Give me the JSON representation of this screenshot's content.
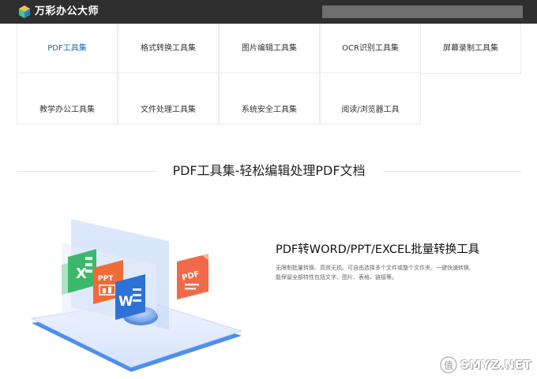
{
  "header": {
    "brand": "万彩办公大师",
    "brand_color": "#2f2f2f",
    "logo_icon": "cube-logo-icon",
    "search_bar_color": "#6f6f6f"
  },
  "tabs": [
    {
      "label": "PDF工具集",
      "active": true
    },
    {
      "label": "格式转换工具集",
      "active": false
    },
    {
      "label": "图片编辑工具集",
      "active": false
    },
    {
      "label": "OCR识别工具集",
      "active": false
    },
    {
      "label": "屏幕录制工具集",
      "active": false
    },
    {
      "label": "教学办公工具集",
      "active": false
    },
    {
      "label": "文件处理工具集",
      "active": false
    },
    {
      "label": "系统安全工具集",
      "active": false
    },
    {
      "label": "阅读/浏览器工具",
      "active": false
    }
  ],
  "section": {
    "title": "PDF工具集-轻松编辑处理PDF文档"
  },
  "feature": {
    "title": "PDF转WORD/PPT/EXCEL批量转换工具",
    "desc_line1": "无限制批量转换、高效无损。可自由选择多个文件或整个文件夹，一键快速转换,",
    "desc_line2": "能保留全部特性包括文字、图片、表格、链接等。"
  },
  "illustration": {
    "excel_label": "X",
    "ppt_label": "PPT",
    "word_label": "W",
    "pdf_label": "PDF"
  },
  "watermark": {
    "text": "SMYZ.NET",
    "icon": "value-worth-icon"
  },
  "colors": {
    "accent": "#2f7ad8",
    "excel": "#3cb86b",
    "ppt": "#ef6b3a",
    "word": "#2f72d6",
    "pdf": "#f06a4a"
  }
}
